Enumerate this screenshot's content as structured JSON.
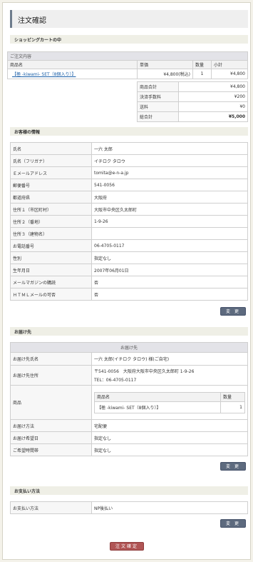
{
  "page_title": "注文確認",
  "cart": {
    "section_title": "ショッピングカートの中",
    "caption": "ご注文内容",
    "headers": [
      "商品名",
      "単価",
      "数量",
      "小計"
    ],
    "item": {
      "name": "【極 -kiwami- SET（8個入り）】",
      "price": "¥4,800(税込)",
      "qty": "1",
      "subtotal": "¥4,800"
    },
    "totals": [
      {
        "label": "商品合計",
        "value": "¥4,800"
      },
      {
        "label": "決済手数料",
        "value": "¥200"
      },
      {
        "label": "送料",
        "value": "¥0"
      },
      {
        "label": "総合計",
        "value": "¥5,000"
      }
    ]
  },
  "customer": {
    "section_title": "お客様の情報",
    "rows": [
      {
        "label": "氏名",
        "value": "一六 太郎"
      },
      {
        "label": "氏名（フリガナ）",
        "value": "イチロク タロウ"
      },
      {
        "label": "Ｅメールアドレス",
        "value": "tomita@e-n-a.jp"
      },
      {
        "label": "郵便番号",
        "value": "541-0056"
      },
      {
        "label": "都道府県",
        "value": "大阪府"
      },
      {
        "label": "住所１（市区町村）",
        "value": "大阪市中央区久太郎町"
      },
      {
        "label": "住所２（番地）",
        "value": "1-9-26"
      },
      {
        "label": "住所３（建物名）",
        "value": ""
      },
      {
        "label": "お電話番号",
        "value": "06-4705-0117"
      },
      {
        "label": "性別",
        "value": "指定なし"
      },
      {
        "label": "生年月日",
        "value": "2007年06月01日"
      },
      {
        "label": "メールマガジンの購読",
        "value": "否"
      },
      {
        "label": "ＨＴＭＬメールの可否",
        "value": "否"
      }
    ],
    "change_button": "変 更"
  },
  "delivery": {
    "section_title": "お届け先",
    "caption": "お届け先",
    "name_label": "お届け先氏名",
    "name_value": "一六 太郎(イチロク タロウ) 様(ご自宅)",
    "address_label": "お届け先住所",
    "address_line1": "〒541-0056　大阪府大阪市中央区久太郎町 1-9-26",
    "address_line2": "TEL：06-4705-0117",
    "goods_label": "商品",
    "goods_headers": [
      "商品名",
      "数量"
    ],
    "goods_item": {
      "name": "【極 -kiwami- SET（8個入り）】",
      "qty": "1"
    },
    "method_label": "お届け方法",
    "method_value": "宅配便",
    "date_label": "お届け希望日",
    "date_value": "指定なし",
    "time_label": "ご希望時間帯",
    "time_value": "指定なし",
    "change_button": "変 更"
  },
  "payment": {
    "section_title": "お支払い方法",
    "label": "お支払い方法",
    "value": "NP後払い",
    "change_button": "変 更"
  },
  "confirm_button": "注文確定"
}
